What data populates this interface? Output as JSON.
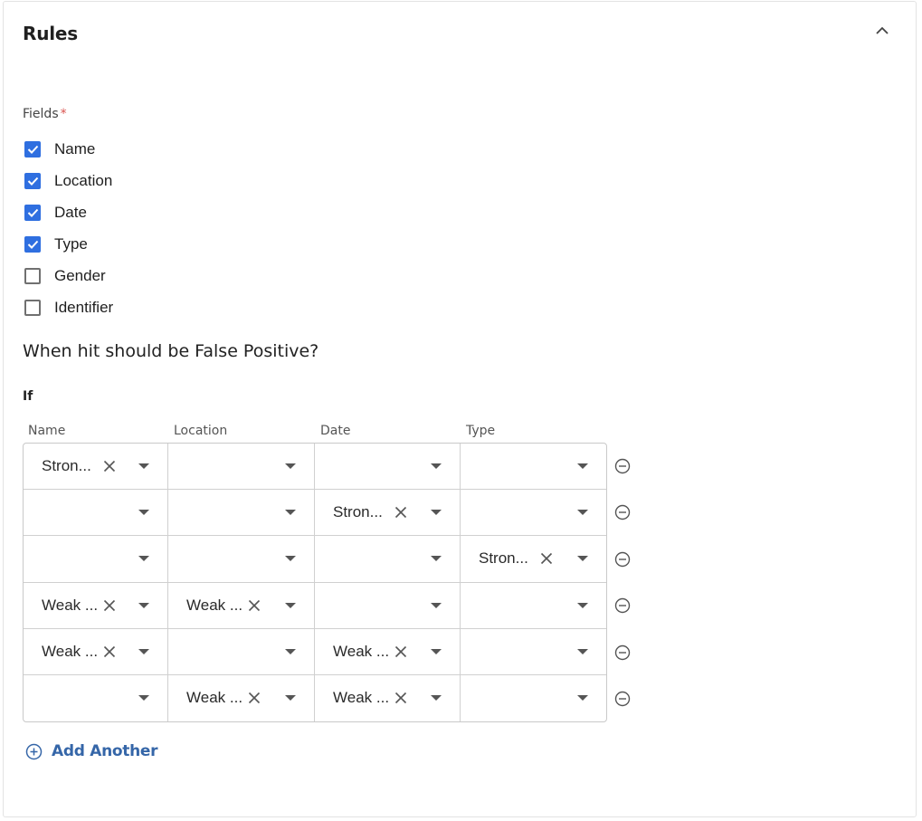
{
  "section": {
    "title": "Rules",
    "collapse_icon": "chevron-up-icon"
  },
  "fields": {
    "label": "Fields",
    "required_mark": "*",
    "options": [
      {
        "label": "Name",
        "checked": true
      },
      {
        "label": "Location",
        "checked": true
      },
      {
        "label": "Date",
        "checked": true
      },
      {
        "label": "Type",
        "checked": true
      },
      {
        "label": "Gender",
        "checked": false
      },
      {
        "label": "Identifier",
        "checked": false
      }
    ]
  },
  "question": "When hit should be False Positive?",
  "rules": {
    "if_label": "If",
    "columns": [
      "Name",
      "Location",
      "Date",
      "Type"
    ],
    "rows": [
      [
        "Stron...",
        "",
        "",
        ""
      ],
      [
        "",
        "",
        "Stron...",
        ""
      ],
      [
        "",
        "",
        "",
        "Stron..."
      ],
      [
        "Weak ...",
        "Weak ...",
        "",
        ""
      ],
      [
        "Weak ...",
        "",
        "Weak ...",
        ""
      ],
      [
        "",
        "Weak ...",
        "Weak ...",
        ""
      ]
    ],
    "remove_icon": "minus-circle-icon",
    "clear_icon": "close-icon",
    "dropdown_icon": "caret-down-icon"
  },
  "add_another": {
    "label": "Add Another",
    "icon": "plus-circle-icon"
  },
  "colors": {
    "checkbox_checked": "#2f6fe0",
    "link": "#3566a8",
    "required": "#d9534f"
  }
}
